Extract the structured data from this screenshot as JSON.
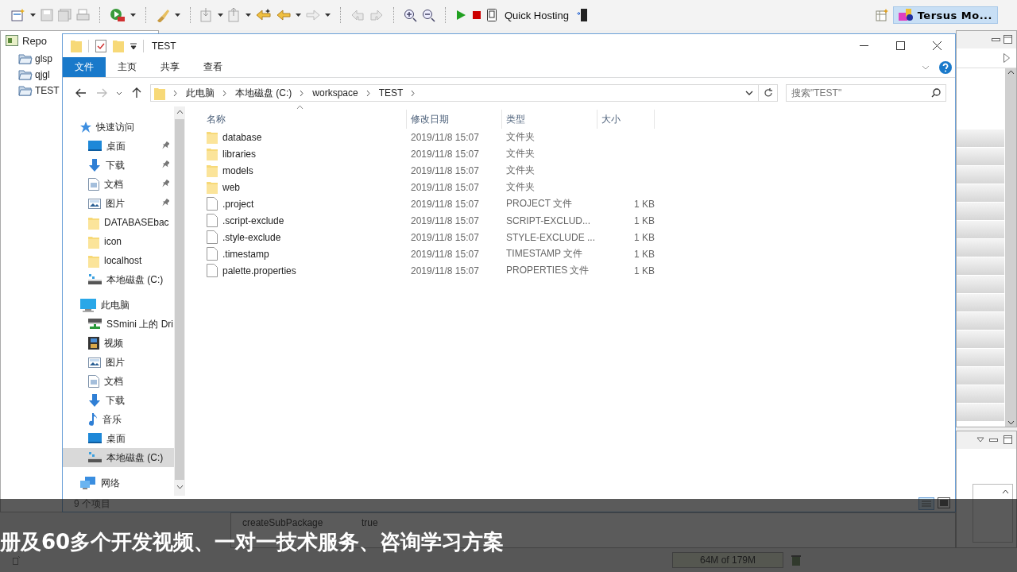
{
  "ide": {
    "toolbar": {
      "quick_hosting": "Quick Hosting",
      "perspective": "Tersus Mo..."
    },
    "repo_tab": "Repo",
    "repo_tree": [
      {
        "label": "glsp"
      },
      {
        "label": "qjgl"
      },
      {
        "label": "TEST"
      }
    ],
    "properties": [
      {
        "name": "createSubPackage",
        "value": "true"
      }
    ],
    "heap": "64M of 179M"
  },
  "explorer": {
    "title": "TEST",
    "ribbon_tabs": [
      {
        "label": "文件",
        "selected": true
      },
      {
        "label": "主页",
        "selected": false
      },
      {
        "label": "共享",
        "selected": false
      },
      {
        "label": "查看",
        "selected": false
      }
    ],
    "breadcrumb": [
      "此电脑",
      "本地磁盘 (C:)",
      "workspace",
      "TEST"
    ],
    "search": {
      "placeholder": "搜索\"TEST\""
    },
    "nav": [
      {
        "label": "快速访问",
        "kind": "star",
        "pinned": false,
        "selected": false,
        "children": [
          {
            "label": "桌面",
            "kind": "desktop",
            "pinned": true,
            "selected": false
          },
          {
            "label": "下载",
            "kind": "download",
            "pinned": true,
            "selected": false
          },
          {
            "label": "文档",
            "kind": "document",
            "pinned": true,
            "selected": false
          },
          {
            "label": "图片",
            "kind": "picture",
            "pinned": true,
            "selected": false
          },
          {
            "label": "DATABASEbac",
            "kind": "folder",
            "pinned": false,
            "selected": false
          },
          {
            "label": "icon",
            "kind": "folder",
            "pinned": false,
            "selected": false
          },
          {
            "label": "localhost",
            "kind": "folder",
            "pinned": false,
            "selected": false
          },
          {
            "label": "本地磁盘 (C:)",
            "kind": "drive",
            "pinned": false,
            "selected": false
          }
        ]
      },
      {
        "label": "此电脑",
        "kind": "pc",
        "pinned": false,
        "selected": false,
        "children": [
          {
            "label": "SSmini 上的 Dri",
            "kind": "netdrive",
            "pinned": false,
            "selected": false
          },
          {
            "label": "视频",
            "kind": "video",
            "pinned": false,
            "selected": false
          },
          {
            "label": "图片",
            "kind": "picture",
            "pinned": false,
            "selected": false
          },
          {
            "label": "文档",
            "kind": "document",
            "pinned": false,
            "selected": false
          },
          {
            "label": "下载",
            "kind": "download",
            "pinned": false,
            "selected": false
          },
          {
            "label": "音乐",
            "kind": "music",
            "pinned": false,
            "selected": false
          },
          {
            "label": "桌面",
            "kind": "desktop",
            "pinned": false,
            "selected": false
          },
          {
            "label": "本地磁盘 (C:)",
            "kind": "drive",
            "pinned": false,
            "selected": true
          }
        ]
      },
      {
        "label": "网络",
        "kind": "network",
        "pinned": false,
        "selected": false
      }
    ],
    "columns": [
      "名称",
      "修改日期",
      "类型",
      "大小"
    ],
    "files": [
      {
        "name": "database",
        "kind": "folder",
        "modified": "2019/11/8 15:07",
        "type": "文件夹"
      },
      {
        "name": "libraries",
        "kind": "folder",
        "modified": "2019/11/8 15:07",
        "type": "文件夹"
      },
      {
        "name": "models",
        "kind": "folder",
        "modified": "2019/11/8 15:07",
        "type": "文件夹"
      },
      {
        "name": "web",
        "kind": "folder",
        "modified": "2019/11/8 15:07",
        "type": "文件夹"
      },
      {
        "name": ".project",
        "kind": "file",
        "modified": "2019/11/8 15:07",
        "type": "PROJECT 文件",
        "size": "1 KB"
      },
      {
        "name": ".script-exclude",
        "kind": "file",
        "modified": "2019/11/8 15:07",
        "type": "SCRIPT-EXCLUD...",
        "size": "1 KB"
      },
      {
        "name": ".style-exclude",
        "kind": "file",
        "modified": "2019/11/8 15:07",
        "type": "STYLE-EXCLUDE ...",
        "size": "1 KB"
      },
      {
        "name": ".timestamp",
        "kind": "file",
        "modified": "2019/11/8 15:07",
        "type": "TIMESTAMP 文件",
        "size": "1 KB"
      },
      {
        "name": "palette.properties",
        "kind": "file",
        "modified": "2019/11/8 15:07",
        "type": "PROPERTIES 文件",
        "size": "1 KB"
      }
    ],
    "status": "9 个项目"
  },
  "caption": "册及60多个开发视频、一对一技术服务、咨询学习方案"
}
